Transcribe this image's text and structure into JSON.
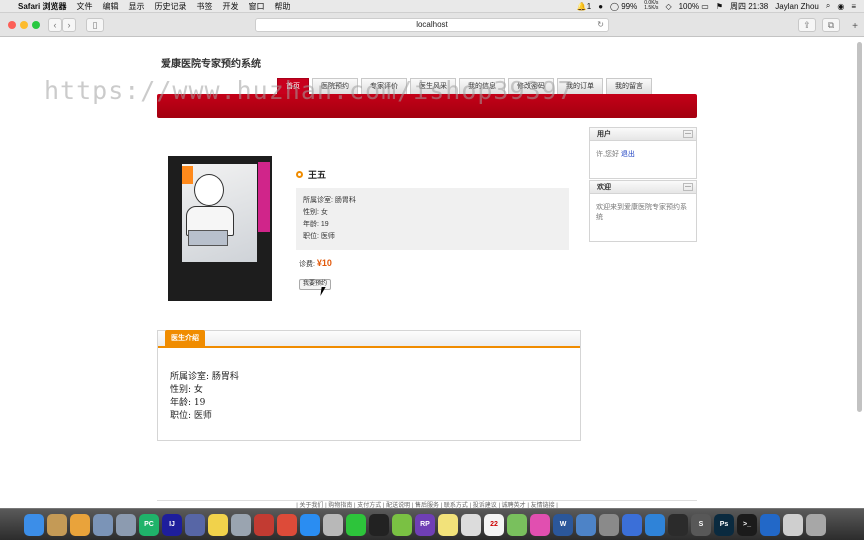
{
  "menubar": {
    "app_name": "Safari 浏览器",
    "menus": [
      "文件",
      "编辑",
      "显示",
      "历史记录",
      "书签",
      "开发",
      "窗口",
      "帮助"
    ],
    "notification_count": "1",
    "cpu_percent": "99%",
    "net_up": "0.0K/s",
    "net_down": "1.5K/s",
    "battery": "100%",
    "clock": "周四 21:38",
    "user": "Jaylan Zhou"
  },
  "browser": {
    "url": "localhost",
    "back_icon": "chevron-left-icon",
    "forward_icon": "chevron-right-icon"
  },
  "site": {
    "title": "爱康医院专家预约系统",
    "watermark": "https://www.huzhan.com/ishop39397",
    "nav": [
      {
        "label": "首页",
        "active": true
      },
      {
        "label": "医院预约",
        "active": false
      },
      {
        "label": "专家评价",
        "active": false
      },
      {
        "label": "医生风采",
        "active": false
      },
      {
        "label": "我的信息",
        "active": false
      },
      {
        "label": "修改密码",
        "active": false
      },
      {
        "label": "我的订单",
        "active": false
      },
      {
        "label": "我的留言",
        "active": false
      }
    ]
  },
  "doctor": {
    "name": "王五",
    "department_label": "所属诊室:",
    "department": "肠胃科",
    "gender_label": "性别:",
    "gender": "女",
    "age_label": "年龄:",
    "age": "19",
    "title_label": "职位:",
    "title": "医师",
    "fee_label": "诊费:",
    "fee": "¥10",
    "book_button": "我要预约"
  },
  "sidebar": {
    "user_box": {
      "title": "用户",
      "greeting": "许,您好",
      "logout": "退出",
      "min_label": "—"
    },
    "welcome_box": {
      "title": "欢迎",
      "text": "欢迎来到爱康医院专家预约系统",
      "min_label": "—"
    }
  },
  "intro": {
    "tab": "医生介绍",
    "lines": [
      "所属诊室:  肠胃科",
      "性别:  女",
      "年龄:  19",
      "职位:  医师"
    ]
  },
  "footer": {
    "text": "| 关于我们 | 购物指南 | 支付方式 | 配送说明 | 售后服务 | 联系方式 | 投诉建议 | 诚聘英才 | 友情链接 |"
  },
  "dock": {
    "items": [
      {
        "name": "finder",
        "color": "#3c8ee8",
        "label": ""
      },
      {
        "name": "notes-app",
        "color": "#c49a56",
        "label": ""
      },
      {
        "name": "photos",
        "color": "#e9a33b",
        "label": ""
      },
      {
        "name": "preview",
        "color": "#7b94b7",
        "label": ""
      },
      {
        "name": "launchpad",
        "color": "#8c9bb0",
        "label": ""
      },
      {
        "name": "pycharm",
        "color": "#1fb36a",
        "label": "PC"
      },
      {
        "name": "intellij",
        "color": "#1e1e9c",
        "label": "IJ"
      },
      {
        "name": "stack-app",
        "color": "#5766a6",
        "label": ""
      },
      {
        "name": "banana-app",
        "color": "#f1d24b",
        "label": ""
      },
      {
        "name": "ftp-app",
        "color": "#9aa4b0",
        "label": ""
      },
      {
        "name": "redis-app",
        "color": "#c23b32",
        "label": ""
      },
      {
        "name": "chrome-app",
        "color": "#dd4b39",
        "label": ""
      },
      {
        "name": "safari",
        "color": "#2a8df2",
        "label": ""
      },
      {
        "name": "mail-app",
        "color": "#b8b8b8",
        "label": ""
      },
      {
        "name": "wechat",
        "color": "#2dc43b",
        "label": ""
      },
      {
        "name": "qq",
        "color": "#222222",
        "label": ""
      },
      {
        "name": "game-app",
        "color": "#7ac143",
        "label": ""
      },
      {
        "name": "axure",
        "color": "#6f3fb5",
        "label": "RP"
      },
      {
        "name": "notes-yellow",
        "color": "#f2e27a",
        "label": ""
      },
      {
        "name": "notebook-app",
        "color": "#dcdcdc",
        "label": ""
      },
      {
        "name": "calendar-app",
        "color": "#f5f5f5",
        "label": "22"
      },
      {
        "name": "maps-app",
        "color": "#79c05d",
        "label": ""
      },
      {
        "name": "itunes",
        "color": "#e14fb0",
        "label": ""
      },
      {
        "name": "word",
        "color": "#2b579a",
        "label": "W"
      },
      {
        "name": "finder-2",
        "color": "#4d83c7",
        "label": ""
      },
      {
        "name": "settings",
        "color": "#8a8a8a",
        "label": ""
      },
      {
        "name": "baidu-app",
        "color": "#3b6fd8",
        "label": ""
      },
      {
        "name": "teamviewer",
        "color": "#2f83d8",
        "label": ""
      },
      {
        "name": "qq-2",
        "color": "#2b2b2b",
        "label": ""
      },
      {
        "name": "sublime",
        "color": "#585858",
        "label": "S"
      },
      {
        "name": "photoshop",
        "color": "#0a2a3f",
        "label": "Ps"
      },
      {
        "name": "terminal",
        "color": "#1b1b1b",
        "label": ">_"
      },
      {
        "name": "browser-2",
        "color": "#2268c8",
        "label": ""
      },
      {
        "name": "music-folder",
        "color": "#cfcfcf",
        "label": ""
      },
      {
        "name": "trash",
        "color": "#a7a7a7",
        "label": ""
      }
    ]
  }
}
